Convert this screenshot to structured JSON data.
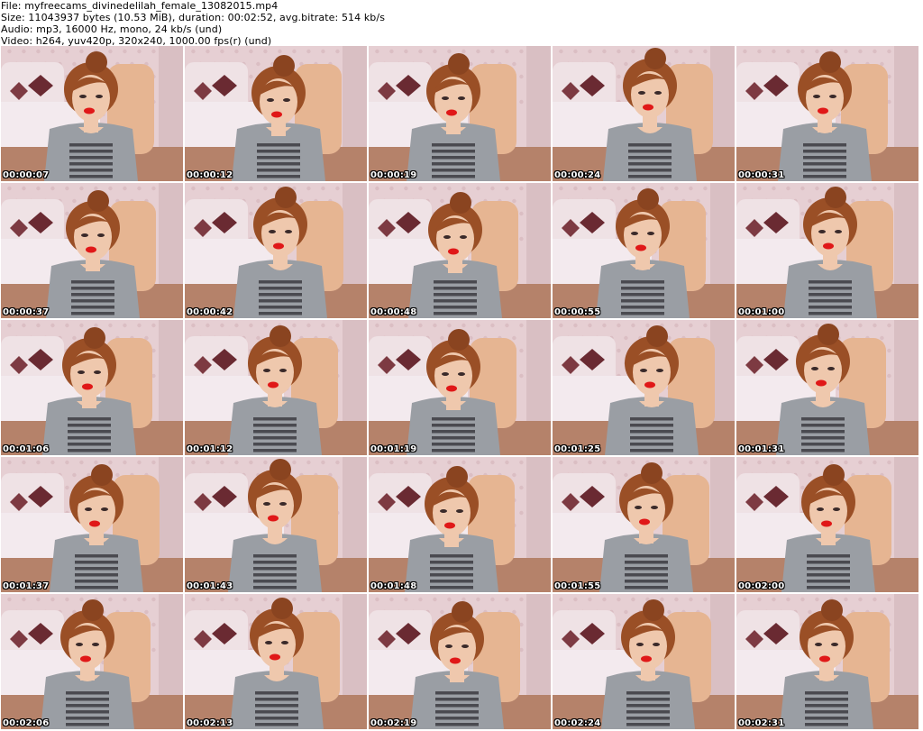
{
  "header": {
    "file_line": "File: myfreecams_divinedelilah_female_13082015.mp4",
    "size_line": "Size: 11043937 bytes (10.53 MiB), duration: 00:02:52, avg.bitrate: 514 kb/s",
    "audio_line": "Audio: mp3, 16000 Hz, mono, 24 kb/s (und)",
    "video_line": "Video: h264, yuv420p, 320x240, 1000.00 fps(r) (und)"
  },
  "colors": {
    "wall": "#e6cfd3",
    "bed": "#f3eaee",
    "pillow": "#6a2a32",
    "chair": "#e6b592",
    "shirt": "#9a9ea4",
    "stripes": "#4a4a50",
    "skin": "#efc8ad",
    "hair": "#9a4f26",
    "lips": "#e01818"
  },
  "thumbnails": [
    {
      "timestamp": "00:00:07"
    },
    {
      "timestamp": "00:00:12"
    },
    {
      "timestamp": "00:00:19"
    },
    {
      "timestamp": "00:00:24"
    },
    {
      "timestamp": "00:00:31"
    },
    {
      "timestamp": "00:00:37"
    },
    {
      "timestamp": "00:00:42"
    },
    {
      "timestamp": "00:00:48"
    },
    {
      "timestamp": "00:00:55"
    },
    {
      "timestamp": "00:01:00"
    },
    {
      "timestamp": "00:01:06"
    },
    {
      "timestamp": "00:01:12"
    },
    {
      "timestamp": "00:01:19"
    },
    {
      "timestamp": "00:01:25"
    },
    {
      "timestamp": "00:01:31"
    },
    {
      "timestamp": "00:01:37"
    },
    {
      "timestamp": "00:01:43"
    },
    {
      "timestamp": "00:01:48"
    },
    {
      "timestamp": "00:01:55"
    },
    {
      "timestamp": "00:02:00"
    },
    {
      "timestamp": "00:02:06"
    },
    {
      "timestamp": "00:02:13"
    },
    {
      "timestamp": "00:02:19"
    },
    {
      "timestamp": "00:02:24"
    },
    {
      "timestamp": "00:02:31"
    }
  ]
}
